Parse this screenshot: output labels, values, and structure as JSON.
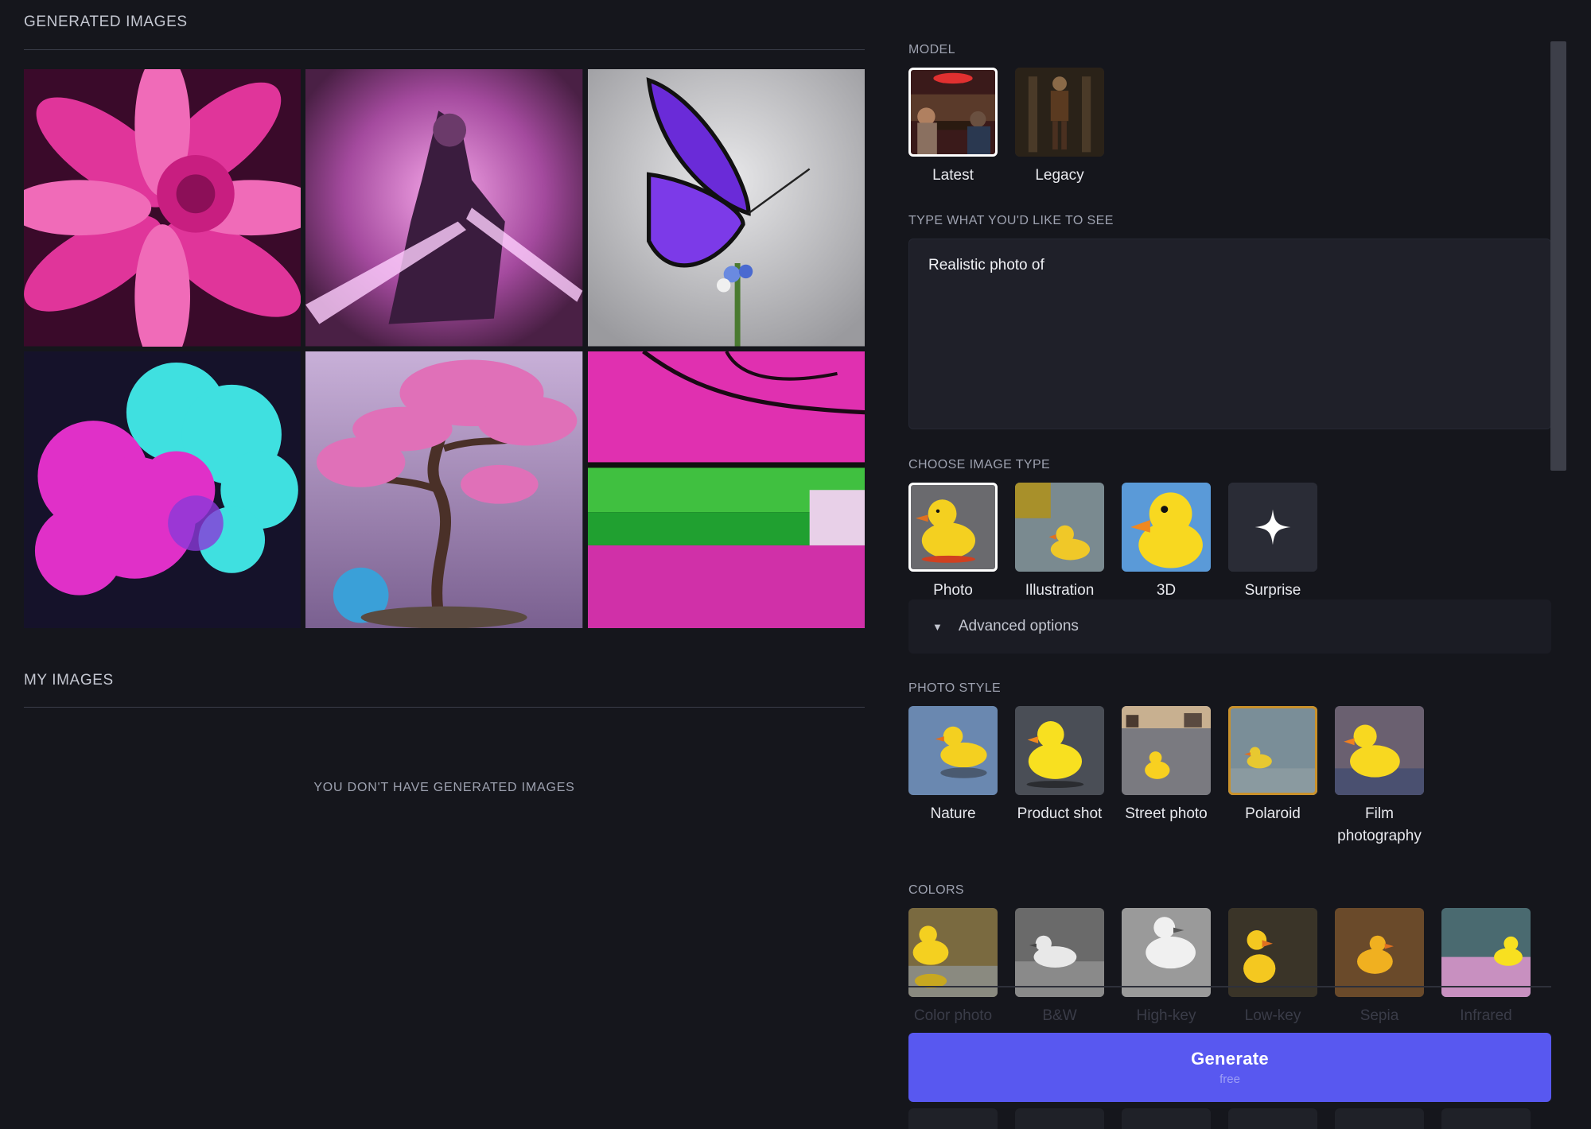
{
  "generated": {
    "title": "GENERATED IMAGES"
  },
  "my_images": {
    "title": "MY IMAGES",
    "empty_message": "YOU DON'T HAVE GENERATED IMAGES"
  },
  "model": {
    "label": "MODEL",
    "options": [
      {
        "label": "Latest",
        "selected": true
      },
      {
        "label": "Legacy",
        "selected": false
      }
    ]
  },
  "prompt": {
    "label": "TYPE WHAT YOU'D LIKE TO SEE",
    "value": "Realistic photo of"
  },
  "image_type": {
    "label": "CHOOSE IMAGE TYPE",
    "options": [
      {
        "label": "Photo",
        "selected": true
      },
      {
        "label": "Illustration",
        "selected": false
      },
      {
        "label": "3D",
        "selected": false
      },
      {
        "label": "Surprise",
        "selected": false
      }
    ]
  },
  "advanced": {
    "label": "Advanced options"
  },
  "photo_style": {
    "label": "PHOTO STYLE",
    "options": [
      {
        "label": "Nature"
      },
      {
        "label": "Product shot"
      },
      {
        "label": "Street photo"
      },
      {
        "label": "Polaroid",
        "selected": true
      },
      {
        "label": "Film photography"
      }
    ]
  },
  "colors": {
    "label": "COLORS",
    "options": [
      {
        "label": "Color photo"
      },
      {
        "label": "B&W"
      },
      {
        "label": "High-key"
      },
      {
        "label": "Low-key"
      },
      {
        "label": "Sepia"
      },
      {
        "label": "Infrared"
      }
    ]
  },
  "generate": {
    "label": "Generate",
    "sublabel": "free"
  },
  "theme": {
    "accent": "#5858f0",
    "background": "#15161c",
    "panel": "#1f2029",
    "selected_gold": "#c9912b"
  }
}
